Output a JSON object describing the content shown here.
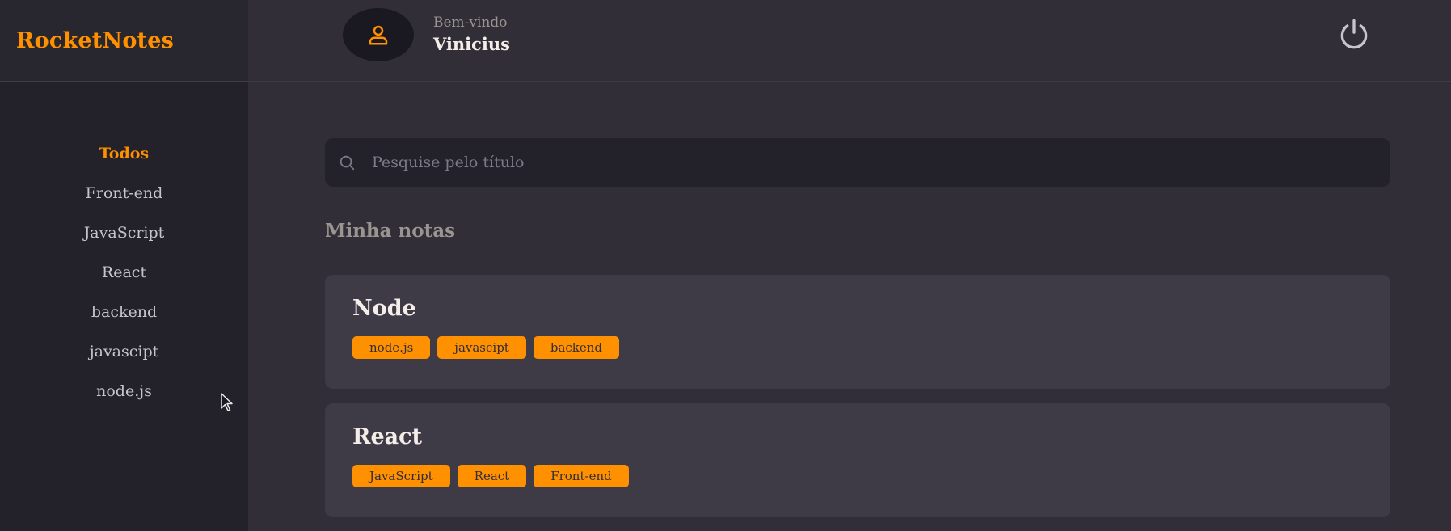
{
  "brand": "RocketNotes",
  "header": {
    "welcome_label": "Bem-vindo",
    "user_name": "Vinicius",
    "avatar_icon": "user-icon",
    "logout_icon": "power-icon"
  },
  "sidebar": {
    "items": [
      {
        "label": "Todos",
        "active": true
      },
      {
        "label": "Front-end"
      },
      {
        "label": "JavaScript"
      },
      {
        "label": "React"
      },
      {
        "label": "backend"
      },
      {
        "label": "javascipt"
      },
      {
        "label": "node.js"
      }
    ]
  },
  "search": {
    "placeholder": "Pesquise pelo título",
    "icon": "search-icon"
  },
  "section_title": "Minha notas",
  "notes": [
    {
      "title": "Node",
      "tags": [
        "node.js",
        "javascipt",
        "backend"
      ]
    },
    {
      "title": "React",
      "tags": [
        "JavaScript",
        "React",
        "Front-end"
      ]
    }
  ],
  "colors": {
    "accent": "#ff9000",
    "background": "#312e38",
    "sidebar": "#232129",
    "card": "#3e3b47"
  }
}
